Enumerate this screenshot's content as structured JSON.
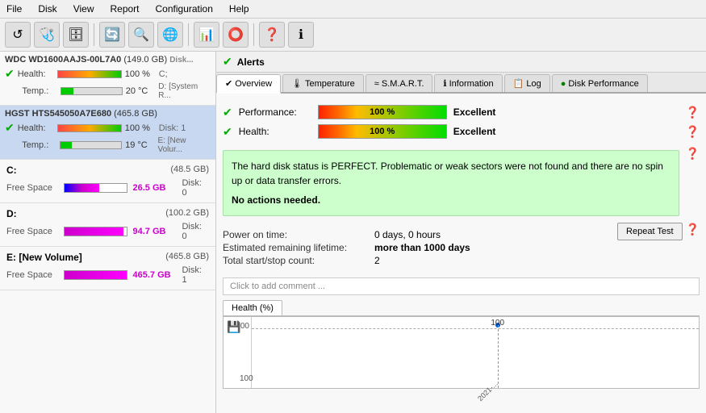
{
  "menu": {
    "items": [
      "File",
      "Disk",
      "View",
      "Report",
      "Configuration",
      "Help"
    ]
  },
  "toolbar": {
    "buttons": [
      "⟳",
      "🔍",
      "📋",
      "💾",
      "📤",
      "📥",
      "🔧",
      "📊",
      "❓",
      "ℹ"
    ]
  },
  "left": {
    "disk1": {
      "name": "WDC WD1600AAJS-00L7A0",
      "size": "(149.0 GB)",
      "suffix": "Disk...",
      "health_label": "Health:",
      "health_value": "100 %",
      "temp_label": "Temp.:",
      "temp_value": "20 °C",
      "extra": "C;",
      "extra2": "D: [System R..."
    },
    "disk2": {
      "name": "HGST HTS545050A7E680",
      "size": "(465.8 GB)",
      "health_label": "Health:",
      "health_value": "100 %",
      "temp_label": "Temp.:",
      "temp_value": "19 °C",
      "extra": "Disk: 1",
      "extra2": "E: [New Volur..."
    },
    "drives": [
      {
        "letter": "C:",
        "size": "(48.5 GB)",
        "free_label": "Free Space",
        "free_value": "26.5 GB",
        "disk": "Disk: 0",
        "bar_type": "c"
      },
      {
        "letter": "D:",
        "size": "(100.2 GB)",
        "free_label": "Free Space",
        "free_value": "94.7 GB",
        "disk": "Disk: 0",
        "bar_type": "d"
      },
      {
        "letter": "E: [New Volume]",
        "size": "(465.8 GB)",
        "free_label": "Free Space",
        "free_value": "465.7 GB",
        "disk": "Disk: 1",
        "bar_type": "e"
      }
    ]
  },
  "right": {
    "alerts_label": "Alerts",
    "tabs": [
      {
        "label": "Overview",
        "icon": "✔",
        "active": true
      },
      {
        "label": "Temperature",
        "icon": "🌡"
      },
      {
        "label": "S.M.A.R.T.",
        "icon": "~"
      },
      {
        "label": "Information",
        "icon": "ℹ"
      },
      {
        "label": "Log",
        "icon": "📋"
      },
      {
        "label": "Disk Performance",
        "icon": "●"
      }
    ],
    "performance": {
      "label": "Performance:",
      "value": "100 %",
      "status": "Excellent"
    },
    "health": {
      "label": "Health:",
      "value": "100 %",
      "status": "Excellent"
    },
    "status_message": "The hard disk status is PERFECT. Problematic or weak sectors were not found and there are no spin up or data transfer errors.",
    "actions": "No actions needed.",
    "power_on_label": "Power on time:",
    "power_on_value": "0 days, 0 hours",
    "lifetime_label": "Estimated remaining lifetime:",
    "lifetime_value": "more than 1000 days",
    "startstop_label": "Total start/stop count:",
    "startstop_value": "2",
    "repeat_btn": "Repeat Test",
    "comment_placeholder": "Click to add comment ...",
    "chart_tab": "Health (%)",
    "chart_y_top": "100",
    "chart_y_bottom": "100",
    "chart_data_value": "100",
    "chart_x_label": "2021-..."
  }
}
